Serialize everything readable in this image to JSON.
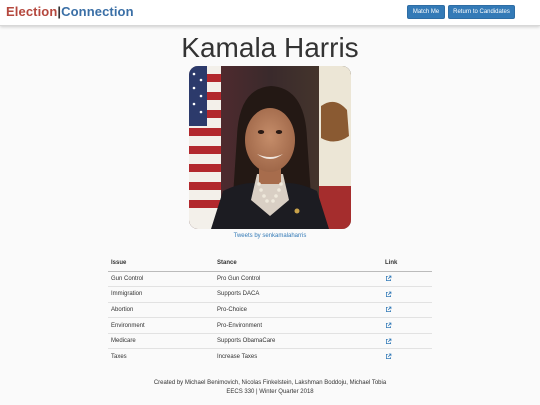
{
  "navbar": {
    "brand_left": "Election",
    "brand_sep": "|",
    "brand_right": "Connection",
    "match_label": "Match Me",
    "return_label": "Return to Candidates"
  },
  "candidate": {
    "name": "Kamala Harris",
    "tweets_link": "Tweets by senkamalaharris"
  },
  "issues_table": {
    "headers": {
      "issue": "Issue",
      "stance": "Stance",
      "link": "Link"
    },
    "rows": [
      {
        "issue": "Gun Control",
        "stance": "Pro Gun Control"
      },
      {
        "issue": "Immigration",
        "stance": "Supports DACA"
      },
      {
        "issue": "Abortion",
        "stance": "Pro-Choice"
      },
      {
        "issue": "Environment",
        "stance": "Pro-Environment"
      },
      {
        "issue": "Medicare",
        "stance": "Supports ObamaCare"
      },
      {
        "issue": "Taxes",
        "stance": "Increase Taxes"
      }
    ],
    "link_icon": "external-link-icon"
  },
  "footer": {
    "line1": "Created by Michael Benimovich, Nicolas Finkelstein, Lakshman Boddoju, Michael Tobia",
    "line2": "EECS 330 | Winter Quarter 2018"
  },
  "colors": {
    "brand_red": "#b5483e",
    "brand_blue": "#3a6fa6",
    "button": "#337ab7",
    "link": "#337ab7"
  }
}
